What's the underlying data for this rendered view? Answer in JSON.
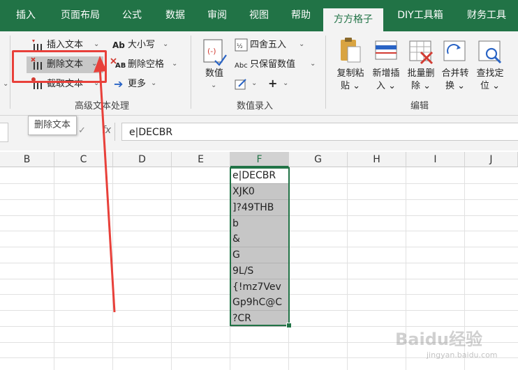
{
  "tabs": [
    "插入",
    "页面布局",
    "公式",
    "数据",
    "审阅",
    "视图",
    "帮助",
    "方方格子",
    "DIY工具箱",
    "财务工具"
  ],
  "active_tab": "方方格子",
  "ribbon": {
    "advanced_text": {
      "insert_text": "插入文本",
      "delete_text": "删除文本",
      "extract_text": "截取文本",
      "case_label": "大小写",
      "case_icon_text": "Ab",
      "delete_spaces": "删除空格",
      "spaces_icon_text": "AB",
      "more": "更多",
      "group_label": "高级文本处理"
    },
    "numeric_entry": {
      "value_btn": "数值",
      "round": "四舍五入",
      "keep_values": "只保留数值",
      "keep_values_icon_text": "Abc",
      "group_label": "数值录入"
    },
    "edit": {
      "copy_paste": [
        "复制粘",
        "贴"
      ],
      "add_insert": [
        "新增插",
        "入"
      ],
      "batch_delete": [
        "批量删",
        "除"
      ],
      "merge_convert": [
        "合并转",
        "换"
      ],
      "find_locate": [
        "查找定",
        "位"
      ],
      "group_label": "编辑"
    }
  },
  "tooltip": "删除文本",
  "formula_bar": {
    "fx": "fx",
    "content": "e|DECBR"
  },
  "columns": [
    "B",
    "C",
    "D",
    "E",
    "F",
    "G",
    "H",
    "I",
    "J"
  ],
  "selected_column": "F",
  "cells_F": [
    "e|DECBR",
    "XJK0",
    "]?49THB",
    "b",
    "&",
    "G",
    "9L/S",
    "{!mz7Vev",
    "Gp9hC@C",
    "?CR"
  ],
  "watermark": {
    "main": "Baidu经验",
    "sub": "jingyan.baidu.com"
  },
  "colors": {
    "excel_green": "#217346",
    "annotation_red": "#e8403a",
    "selection_fill": "#c6c6c6"
  }
}
